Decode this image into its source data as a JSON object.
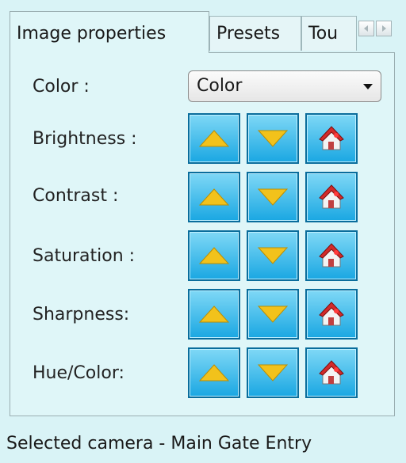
{
  "tabs": [
    {
      "label": "Image properties",
      "active": true
    },
    {
      "label": "Presets",
      "active": false
    },
    {
      "label": "Tou",
      "active": false
    }
  ],
  "color_label": "Color :",
  "color_select_value": "Color",
  "rows": [
    {
      "label": "Brightness :"
    },
    {
      "label": "Contrast :"
    },
    {
      "label": "Saturation :"
    },
    {
      "label": "Sharpness:"
    },
    {
      "label": "Hue/Color:"
    }
  ],
  "icons": {
    "up": "up-arrow-icon",
    "down": "down-arrow-icon",
    "reset": "home-reset-icon"
  },
  "colors": {
    "background": "#d9f3f6",
    "button": "#1aa7e2",
    "arrow": "#f2c21b",
    "house_roof": "#d32a2a"
  },
  "status": "Selected camera - Main Gate Entry"
}
